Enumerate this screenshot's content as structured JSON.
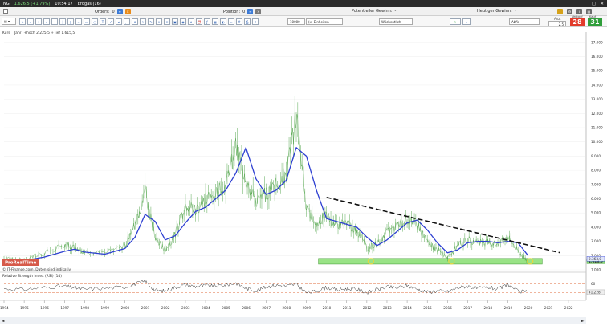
{
  "titlebar": {
    "symbol": "NG",
    "change": "1.626,5 (+1,79%)",
    "time": "10:54:17",
    "asset_name": "Erdgas (16)",
    "controls": [
      "_",
      "□",
      "✕"
    ]
  },
  "orderbar": {
    "orders_label": "Orders:",
    "orders_value": "0",
    "position_label": "Position:",
    "position_value": "0",
    "potential_label": "Potentieller Gewinn:",
    "potential_value": "-",
    "current_label": "Heutiger Gewinn:",
    "current_value": "-"
  },
  "toolbar": {
    "symbol_label": "Kurs",
    "quantity": "10000",
    "unit": "(x) Einheiten",
    "period": "Wöchentlich",
    "order_type": "Abfid",
    "qty_label": "Anz.",
    "qty_value": "2.5",
    "sell_label": "Verkauf",
    "sell_price": "28",
    "buy_label": "Kauf",
    "buy_price": "31"
  },
  "chart_header": {
    "kurs": "Kurs",
    "info": "Jahr: +hoch 2.225,5 +Tief 1.615,5"
  },
  "chart_data": {
    "type": "line",
    "title": "",
    "x_ticks": [
      "1994",
      "1995",
      "1996",
      "1997",
      "1998",
      "1999",
      "2000",
      "2001",
      "2002",
      "2003",
      "2004",
      "2005",
      "2006",
      "2007",
      "2008",
      "2009",
      "2010",
      "2011",
      "2012",
      "2013",
      "2014",
      "2015",
      "2016",
      "2017",
      "2018",
      "2019",
      "2020",
      "2021",
      "2022"
    ],
    "y_ticks": [
      "1.000",
      "2.000",
      "3.000",
      "4.000",
      "5.000",
      "6.000",
      "7.000",
      "8.000",
      "9.000",
      "10.000",
      "11.000",
      "12.000",
      "13.000",
      "14.000",
      "15.000",
      "16.000",
      "17.000"
    ],
    "ylim": [
      1000,
      17500
    ],
    "x": [
      1994.0,
      1995.0,
      1996.0,
      1997.0,
      1997.5,
      1998.0,
      1999.0,
      2000.0,
      2000.5,
      2001.0,
      2001.5,
      2002.0,
      2002.5,
      2003.0,
      2003.5,
      2004.0,
      2004.5,
      2005.0,
      2005.5,
      2006.0,
      2006.5,
      2007.0,
      2007.5,
      2008.0,
      2008.5,
      2009.0,
      2009.5,
      2010.0,
      2010.5,
      2011.0,
      2011.5,
      2012.0,
      2012.5,
      2013.0,
      2013.5,
      2014.0,
      2014.5,
      2015.0,
      2015.5,
      2016.0,
      2016.5,
      2017.0,
      2017.5,
      2018.0,
      2018.5,
      2019.0,
      2019.5,
      2020.0
    ],
    "series": [
      {
        "name": "Erdgas",
        "values": [
          1800,
          1700,
          2200,
          2700,
          2600,
          2200,
          2200,
          2700,
          4200,
          6500,
          3200,
          2400,
          3500,
          5600,
          5200,
          5900,
          6500,
          7000,
          9500,
          7500,
          5800,
          6300,
          7000,
          7700,
          12000,
          5200,
          4200,
          4800,
          4200,
          4200,
          3900,
          2500,
          2800,
          3600,
          4100,
          4600,
          4200,
          2900,
          2400,
          1900,
          2700,
          3100,
          3000,
          2900,
          2800,
          3300,
          2300,
          1600
        ]
      },
      {
        "name": "Gleitender Durchschnitt",
        "values": [
          1700,
          1650,
          1900,
          2300,
          2450,
          2250,
          2100,
          2500,
          3300,
          4900,
          4400,
          3100,
          3400,
          4300,
          5100,
          5400,
          6000,
          6600,
          7800,
          9600,
          7400,
          6300,
          6600,
          7300,
          9600,
          9000,
          6600,
          4600,
          4400,
          4200,
          4000,
          3300,
          2700,
          3100,
          3700,
          4300,
          4500,
          3800,
          2900,
          2200,
          2400,
          2900,
          3000,
          3000,
          2900,
          3000,
          2900,
          2000
        ]
      }
    ],
    "annotations": [
      {
        "type": "trendline",
        "x": [
          2010.0,
          2021.6
        ],
        "y": [
          6100,
          2200
        ]
      },
      {
        "type": "support_zone",
        "x": [
          2009.6,
          2020.7
        ],
        "y": [
          1400,
          1800
        ]
      },
      {
        "type": "markers",
        "x": [
          2012.2,
          2016.2,
          2020.1
        ],
        "y": [
          1600,
          1600,
          1600
        ]
      }
    ],
    "price_labels": [
      "1.626,5",
      "2.363,0"
    ],
    "legend": "ProRealTime",
    "source_text": "© IT-Finance.com. Daten sind indikativ.",
    "indicator": {
      "label": "Relative Strength Index (RSI) (14)",
      "y_ticks": [
        "60",
        "40"
      ],
      "current_value": "41,228",
      "values": [
        49,
        47,
        52,
        55,
        51,
        48,
        50,
        53,
        60,
        66,
        45,
        44,
        52,
        58,
        54,
        56,
        55,
        57,
        62,
        50,
        44,
        53,
        57,
        55,
        59,
        40,
        43,
        52,
        46,
        49,
        48,
        40,
        47,
        53,
        51,
        56,
        48,
        41,
        44,
        42,
        51,
        55,
        49,
        52,
        48,
        58,
        43,
        41
      ]
    }
  },
  "timeline": {
    "scroll_left": "◄",
    "scroll_right": "►"
  },
  "colors": {
    "price_line": "#3d9a36",
    "ma_line": "#2d3fd1",
    "support_zone": "#8ee07a",
    "marker": "#e8d640",
    "sell": "#e23b2b",
    "buy": "#2f9e3a",
    "rsi_line": "#333333",
    "rsi_level": "#e06a3a"
  }
}
